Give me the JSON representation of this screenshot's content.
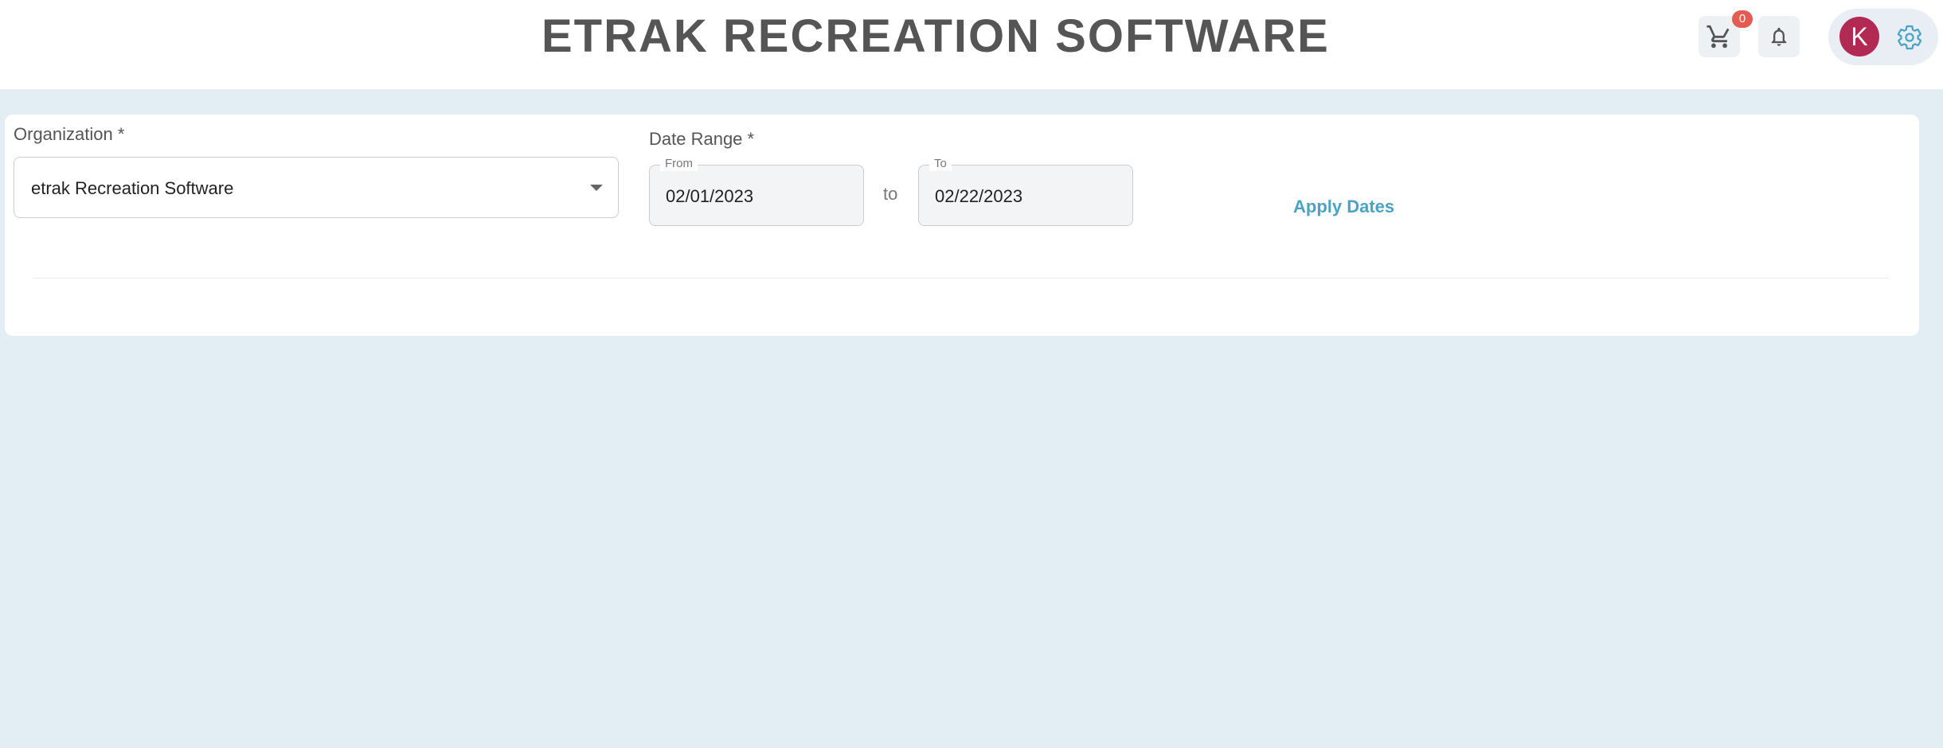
{
  "header": {
    "title": "ETRAK RECREATION SOFTWARE",
    "cart_icon": "cart-icon",
    "cart_count": "0",
    "bell_icon": "bell-icon",
    "avatar_initial": "K",
    "gear_icon": "gear-icon"
  },
  "filters": {
    "organization_label": "Organization *",
    "organization_value": "etrak Recreation Software",
    "date_range_label": "Date Range *",
    "from_label": "From",
    "from_value": "02/01/2023",
    "to_separator": "to",
    "to_label": "To",
    "to_value": "02/22/2023",
    "apply_label": "Apply Dates"
  },
  "colors": {
    "background": "#e2eef3",
    "title": "#555555",
    "badge": "#e45b52",
    "avatar": "#b22954",
    "accent": "#4aa3c5"
  }
}
